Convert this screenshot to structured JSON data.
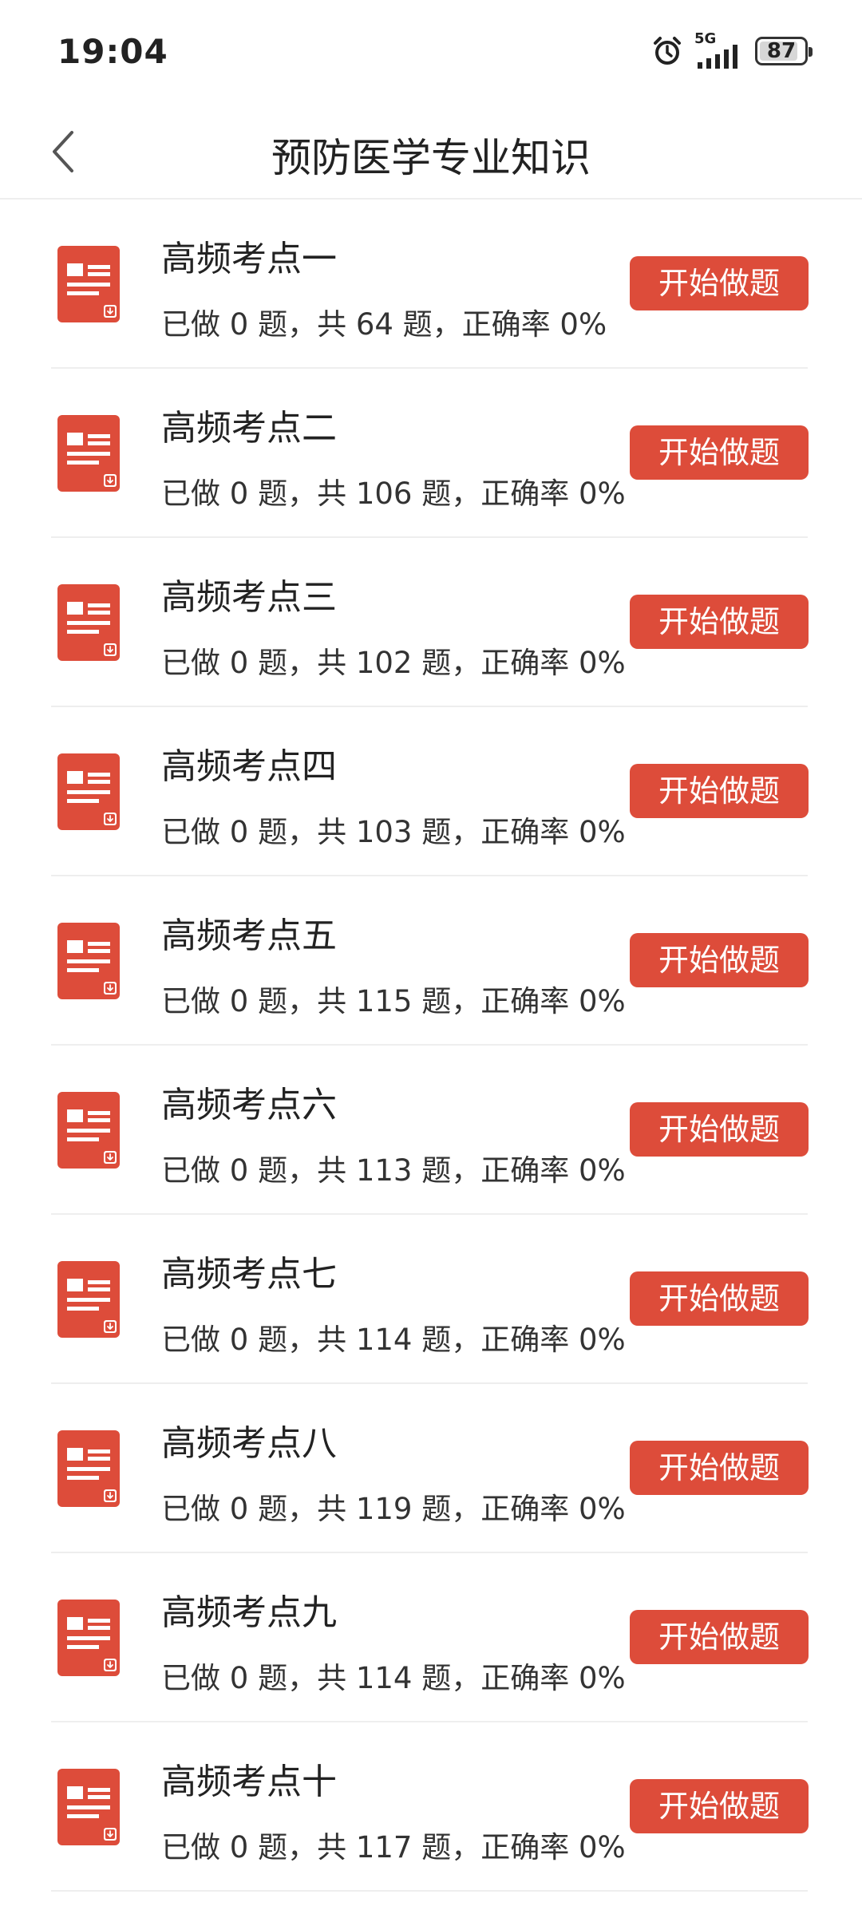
{
  "status_bar": {
    "time": "19:04",
    "network": "5G",
    "battery": "87",
    "battery_level": 0.87,
    "icons": [
      "alarm-icon",
      "signal-icon",
      "battery-icon"
    ]
  },
  "header": {
    "back_icon": "chevron-left-icon",
    "title": "预防医学专业知识"
  },
  "colors": {
    "accent": "#dd4c3a",
    "text": "#333333",
    "divider": "#eeeeee"
  },
  "items": [
    {
      "title": "高频考点一",
      "stats": "已做 0 题，共 64 题，正确率 0%",
      "button": "开始做题"
    },
    {
      "title": "高频考点二",
      "stats": "已做 0 题，共 106 题，正确率 0%",
      "button": "开始做题"
    },
    {
      "title": "高频考点三",
      "stats": "已做 0 题，共 102 题，正确率 0%",
      "button": "开始做题"
    },
    {
      "title": "高频考点四",
      "stats": "已做 0 题，共 103 题，正确率 0%",
      "button": "开始做题"
    },
    {
      "title": "高频考点五",
      "stats": "已做 0 题，共 115 题，正确率 0%",
      "button": "开始做题"
    },
    {
      "title": "高频考点六",
      "stats": "已做 0 题，共 113 题，正确率 0%",
      "button": "开始做题"
    },
    {
      "title": "高频考点七",
      "stats": "已做 0 题，共 114 题，正确率 0%",
      "button": "开始做题"
    },
    {
      "title": "高频考点八",
      "stats": "已做 0 题，共 119 题，正确率 0%",
      "button": "开始做题"
    },
    {
      "title": "高频考点九",
      "stats": "已做 0 题，共 114 题，正确率 0%",
      "button": "开始做题"
    },
    {
      "title": "高频考点十",
      "stats": "已做 0 题，共 117 题，正确率 0%",
      "button": "开始做题"
    }
  ]
}
